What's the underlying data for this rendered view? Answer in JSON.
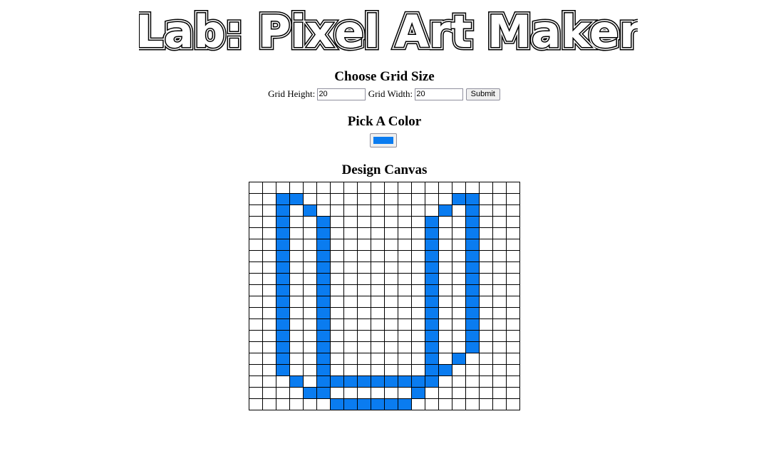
{
  "title": "Lab: Pixel Art Maker",
  "grid_size": {
    "heading": "Choose Grid Size",
    "height_label": "Grid Height:",
    "height_value": "20",
    "width_label": "Grid Width:",
    "width_value": "20",
    "submit_label": "Submit"
  },
  "color": {
    "heading": "Pick A Color",
    "value": "#0a7cf0"
  },
  "canvas": {
    "heading": "Design Canvas",
    "rows": 20,
    "cols": 20,
    "empty_color": "#ffffff",
    "filled": [
      [
        1,
        2
      ],
      [
        1,
        3
      ],
      [
        1,
        15
      ],
      [
        1,
        16
      ],
      [
        2,
        2
      ],
      [
        2,
        4
      ],
      [
        2,
        14
      ],
      [
        2,
        16
      ],
      [
        3,
        2
      ],
      [
        3,
        5
      ],
      [
        3,
        13
      ],
      [
        3,
        16
      ],
      [
        4,
        2
      ],
      [
        4,
        5
      ],
      [
        4,
        13
      ],
      [
        4,
        16
      ],
      [
        5,
        2
      ],
      [
        5,
        5
      ],
      [
        5,
        13
      ],
      [
        5,
        16
      ],
      [
        6,
        2
      ],
      [
        6,
        5
      ],
      [
        6,
        13
      ],
      [
        6,
        16
      ],
      [
        7,
        2
      ],
      [
        7,
        5
      ],
      [
        7,
        13
      ],
      [
        7,
        16
      ],
      [
        8,
        2
      ],
      [
        8,
        5
      ],
      [
        8,
        13
      ],
      [
        8,
        16
      ],
      [
        9,
        2
      ],
      [
        9,
        5
      ],
      [
        9,
        13
      ],
      [
        9,
        16
      ],
      [
        10,
        2
      ],
      [
        10,
        5
      ],
      [
        10,
        13
      ],
      [
        10,
        16
      ],
      [
        11,
        2
      ],
      [
        11,
        5
      ],
      [
        11,
        13
      ],
      [
        11,
        16
      ],
      [
        12,
        2
      ],
      [
        12,
        5
      ],
      [
        12,
        13
      ],
      [
        12,
        16
      ],
      [
        13,
        2
      ],
      [
        13,
        5
      ],
      [
        13,
        13
      ],
      [
        13,
        16
      ],
      [
        14,
        2
      ],
      [
        14,
        5
      ],
      [
        14,
        13
      ],
      [
        14,
        16
      ],
      [
        15,
        2
      ],
      [
        15,
        5
      ],
      [
        15,
        13
      ],
      [
        15,
        15
      ],
      [
        16,
        2
      ],
      [
        16,
        5
      ],
      [
        16,
        13
      ],
      [
        16,
        14
      ],
      [
        17,
        3
      ],
      [
        17,
        5
      ],
      [
        17,
        6
      ],
      [
        17,
        7
      ],
      [
        17,
        8
      ],
      [
        17,
        9
      ],
      [
        17,
        10
      ],
      [
        17,
        11
      ],
      [
        17,
        12
      ],
      [
        17,
        13
      ],
      [
        18,
        4
      ],
      [
        18,
        5
      ],
      [
        18,
        12
      ],
      [
        19,
        6
      ],
      [
        19,
        7
      ],
      [
        19,
        8
      ],
      [
        19,
        9
      ],
      [
        19,
        10
      ],
      [
        19,
        11
      ]
    ]
  }
}
